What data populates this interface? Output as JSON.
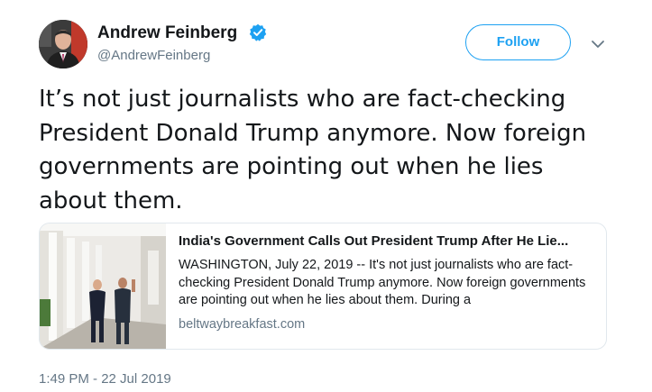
{
  "author": {
    "name": "Andrew Feinberg",
    "handle": "@AndrewFeinberg",
    "verified": true,
    "avatar_icon": "profile-photo"
  },
  "actions": {
    "follow_label": "Follow",
    "more_icon": "chevron-down-icon"
  },
  "tweet": {
    "text": "It’s not just journalists who are fact-checking President Donald Trump anymore. Now foreign governments are pointing out when he lies about them."
  },
  "card": {
    "title": "India's Government Calls Out President Trump After He Lie...",
    "description": "WASHINGTON, July 22, 2019 -- It's not just journalists who are fact-checking President Donald Trump anymore. Now foreign governments are pointing out when he lies about them. During a",
    "domain": "beltwaybreakfast.com",
    "image_icon": "article-thumbnail"
  },
  "timestamp": "1:49 PM - 22 Jul 2019",
  "colors": {
    "accent": "#1da1f2",
    "text": "#14171a",
    "secondary": "#657786",
    "border": "#e1e8ed"
  }
}
